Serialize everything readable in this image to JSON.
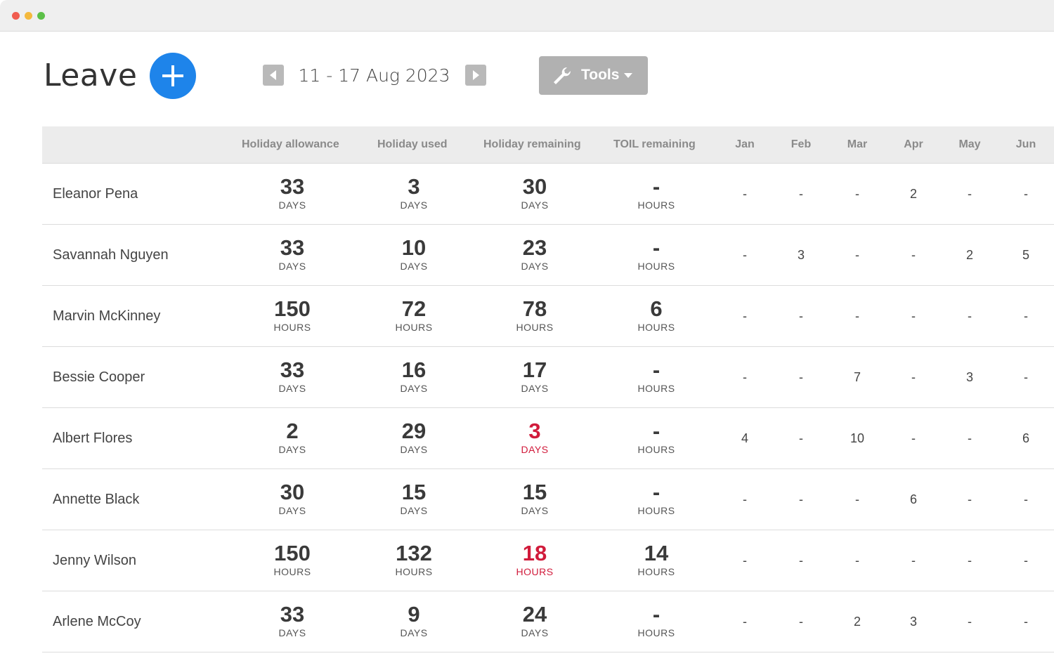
{
  "header": {
    "title": "Leave",
    "date_range": "11 - 17 Aug 2023",
    "tools_label": "Tools"
  },
  "colors": {
    "accent": "#1e84ea",
    "warning": "#d11b3b",
    "tools_bg": "#b1b1b1"
  },
  "icons": [
    "plus-icon",
    "chevron-left-icon",
    "chevron-right-icon",
    "wrench-icon",
    "caret-down-icon"
  ],
  "columns": {
    "allowance": "Holiday allowance",
    "used": "Holiday used",
    "remaining": "Holiday remaining",
    "toil": "TOIL remaining",
    "months": [
      "Jan",
      "Feb",
      "Mar",
      "Apr",
      "May",
      "Jun"
    ]
  },
  "rows": [
    {
      "name": "Eleanor Pena",
      "allowance": {
        "value": "33",
        "unit": "DAYS"
      },
      "used": {
        "value": "3",
        "unit": "DAYS"
      },
      "remaining": {
        "value": "30",
        "unit": "DAYS",
        "warning": false
      },
      "toil": {
        "value": "-",
        "unit": "HOURS"
      },
      "months": [
        "-",
        "-",
        "-",
        "2",
        "-",
        "-"
      ]
    },
    {
      "name": "Savannah Nguyen",
      "allowance": {
        "value": "33",
        "unit": "DAYS"
      },
      "used": {
        "value": "10",
        "unit": "DAYS"
      },
      "remaining": {
        "value": "23",
        "unit": "DAYS",
        "warning": false
      },
      "toil": {
        "value": "-",
        "unit": "HOURS"
      },
      "months": [
        "-",
        "3",
        "-",
        "-",
        "2",
        "5"
      ]
    },
    {
      "name": "Marvin McKinney",
      "allowance": {
        "value": "150",
        "unit": "HOURS"
      },
      "used": {
        "value": "72",
        "unit": "HOURS"
      },
      "remaining": {
        "value": "78",
        "unit": "HOURS",
        "warning": false
      },
      "toil": {
        "value": "6",
        "unit": "HOURS"
      },
      "months": [
        "-",
        "-",
        "-",
        "-",
        "-",
        "-"
      ]
    },
    {
      "name": "Bessie Cooper",
      "allowance": {
        "value": "33",
        "unit": "DAYS"
      },
      "used": {
        "value": "16",
        "unit": "DAYS"
      },
      "remaining": {
        "value": "17",
        "unit": "DAYS",
        "warning": false
      },
      "toil": {
        "value": "-",
        "unit": "HOURS"
      },
      "months": [
        "-",
        "-",
        "7",
        "-",
        "3",
        "-"
      ]
    },
    {
      "name": "Albert Flores",
      "allowance": {
        "value": "2",
        "unit": "DAYS"
      },
      "used": {
        "value": "29",
        "unit": "DAYS"
      },
      "remaining": {
        "value": "3",
        "unit": "DAYS",
        "warning": true
      },
      "toil": {
        "value": "-",
        "unit": "HOURS"
      },
      "months": [
        "4",
        "-",
        "10",
        "-",
        "-",
        "6"
      ]
    },
    {
      "name": "Annette Black",
      "allowance": {
        "value": "30",
        "unit": "DAYS"
      },
      "used": {
        "value": "15",
        "unit": "DAYS"
      },
      "remaining": {
        "value": "15",
        "unit": "DAYS",
        "warning": false
      },
      "toil": {
        "value": "-",
        "unit": "HOURS"
      },
      "months": [
        "-",
        "-",
        "-",
        "6",
        "-",
        "-"
      ]
    },
    {
      "name": "Jenny Wilson",
      "allowance": {
        "value": "150",
        "unit": "HOURS"
      },
      "used": {
        "value": "132",
        "unit": "HOURS"
      },
      "remaining": {
        "value": "18",
        "unit": "HOURS",
        "warning": true
      },
      "toil": {
        "value": "14",
        "unit": "HOURS"
      },
      "months": [
        "-",
        "-",
        "-",
        "-",
        "-",
        "-"
      ]
    },
    {
      "name": "Arlene McCoy",
      "allowance": {
        "value": "33",
        "unit": "DAYS"
      },
      "used": {
        "value": "9",
        "unit": "DAYS"
      },
      "remaining": {
        "value": "24",
        "unit": "DAYS",
        "warning": false
      },
      "toil": {
        "value": "-",
        "unit": "HOURS"
      },
      "months": [
        "-",
        "-",
        "2",
        "3",
        "-",
        "-"
      ]
    }
  ]
}
